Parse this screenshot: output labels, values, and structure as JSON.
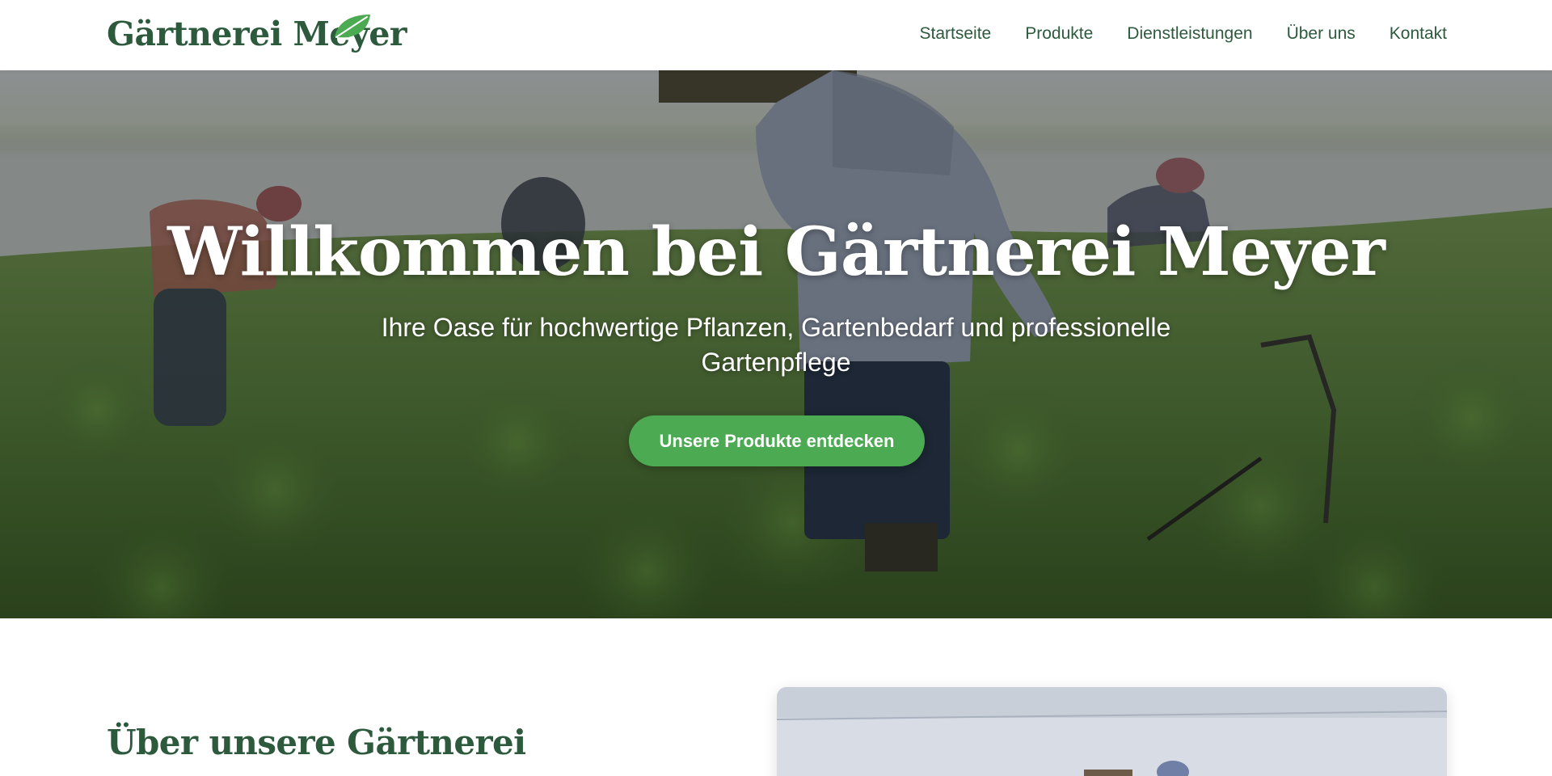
{
  "header": {
    "logo_text": "Gärtnerei Meyer",
    "logo_icon": "leaf-icon",
    "nav": [
      {
        "label": "Startseite"
      },
      {
        "label": "Produkte"
      },
      {
        "label": "Dienstleistungen"
      },
      {
        "label": "Über uns"
      },
      {
        "label": "Kontakt"
      }
    ]
  },
  "hero": {
    "title": "Willkommen bei Gärtnerei Meyer",
    "subtitle": "Ihre Oase für hochwertige Pflanzen, Gartenbedarf und professionelle Gartenpflege",
    "cta_label": "Unsere Produkte entdecken"
  },
  "about": {
    "title": "Über unsere Gärtnerei"
  },
  "colors": {
    "brand_green": "#2d5a3d",
    "accent_green": "#4caa52",
    "header_bg": "#ffffff"
  }
}
